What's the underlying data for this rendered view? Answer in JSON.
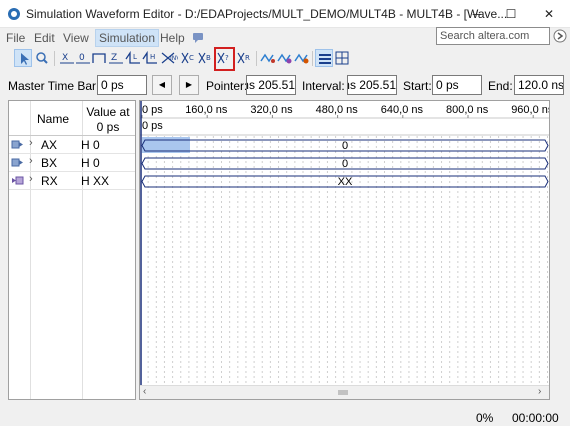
{
  "window": {
    "title": "Simulation Waveform Editor - D:/EDAProjects/MULT_DEMO/MULT4B - MULT4B - [Wave...",
    "minimize_glyph": "─",
    "maximize_glyph": "☐",
    "close_glyph": "✕"
  },
  "menu": {
    "items": [
      "File",
      "Edit",
      "View",
      "Simulation",
      "Help"
    ],
    "active": "Simulation"
  },
  "search": {
    "placeholder": "Search altera.com"
  },
  "timebar": {
    "master_label": "Master Time Bar:",
    "master_value": "0 ps",
    "prev_glyph": "◀",
    "next_glyph": "▶",
    "pointer_label": "Pointer:",
    "pointer_value": "205.51 ns",
    "interval_label": "Interval:",
    "interval_value": "205.51 ns",
    "start_label": "Start:",
    "start_value": "0 ps",
    "end_label": "End:",
    "end_value": "120.0 ns"
  },
  "signals_header": {
    "name": "Name",
    "value_line1": "Value at",
    "value_line2": "0 ps"
  },
  "signals": [
    {
      "name": "AX",
      "value": "H 0",
      "bus_value": "0",
      "kind": "input"
    },
    {
      "name": "BX",
      "value": "H 0",
      "bus_value": "0",
      "kind": "input"
    },
    {
      "name": "RX",
      "value": "H XX",
      "bus_value": "XX",
      "kind": "output"
    }
  ],
  "timeline": {
    "ticks": [
      "0 ps",
      "160,0 ns",
      "320,0 ns",
      "480,0 ns",
      "640,0 ns",
      "800,0 ns",
      "960,0 ns"
    ],
    "cursor_label": "0 ps"
  },
  "status": {
    "progress": "0%",
    "elapsed": "00:00:00"
  },
  "colors": {
    "bus_line": "#1a2f7a",
    "selection": "#a9c6ee",
    "highlight": "#d21f1f"
  }
}
